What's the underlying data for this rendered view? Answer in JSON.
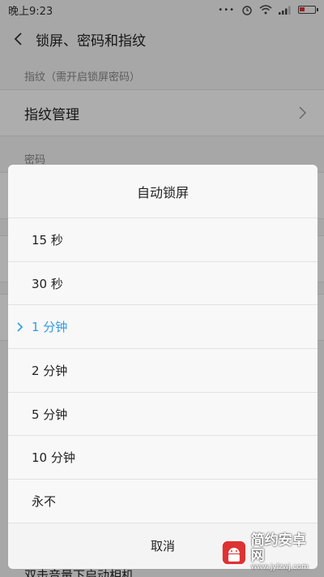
{
  "status_bar": {
    "time": "晚上9:23"
  },
  "header": {
    "title": "锁屏、密码和指纹"
  },
  "sections": {
    "fingerprint_label": "指纹（需开启锁屏密码）",
    "fingerprint_manage": "指纹管理",
    "password_label": "密码",
    "bottom_row": "双击音量下启动相机"
  },
  "dialog": {
    "title": "自动锁屏",
    "options": [
      "15 秒",
      "30 秒",
      "1 分钟",
      "2 分钟",
      "5 分钟",
      "10 分钟",
      "永不"
    ],
    "selected_index": 2,
    "cancel": "取消"
  },
  "watermark": {
    "name": "简约安卓网",
    "url": "www.jylzwj.com"
  },
  "colors": {
    "accent": "#2e9be6",
    "background": "#f7f7f7",
    "dialog": "#f8f8f8"
  }
}
